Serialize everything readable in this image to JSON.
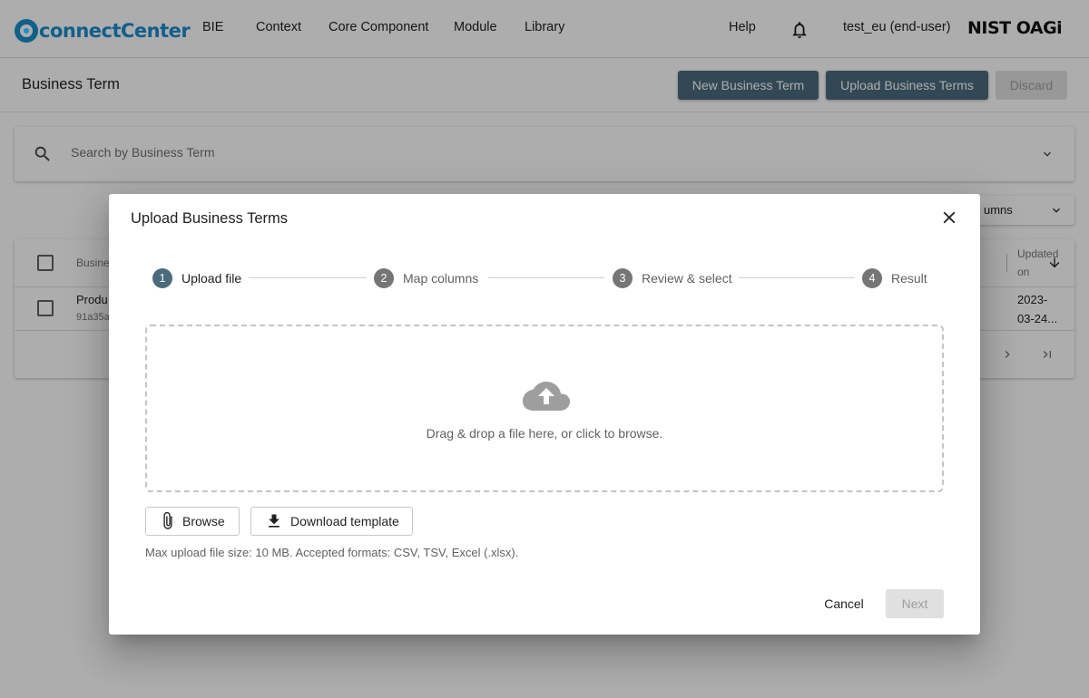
{
  "app": {
    "logo_text": "connectCenter",
    "org_logo": "NIST OAGi"
  },
  "nav": {
    "items": [
      "BIE",
      "Context",
      "Core Component",
      "Module",
      "Library"
    ],
    "help": "Help",
    "user": "test_eu (end-user)"
  },
  "page": {
    "title": "Business Term",
    "buttons": {
      "new": "New Business Term",
      "upload": "Upload Business Terms",
      "discard": "Discard"
    }
  },
  "search": {
    "placeholder": "Search by Business Term"
  },
  "table": {
    "columns_selector": "umns",
    "header_business_term": "Busine",
    "header_updated_on": [
      "Updated",
      "on"
    ],
    "row": {
      "term": "Produ",
      "id": "91a35a",
      "updated_on": [
        "2023-",
        "03-24..."
      ]
    }
  },
  "dialog": {
    "title": "Upload Business Terms",
    "steps": [
      {
        "num": "1",
        "label": "Upload file",
        "active": true
      },
      {
        "num": "2",
        "label": "Map columns",
        "active": false
      },
      {
        "num": "3",
        "label": "Review & select",
        "active": false
      },
      {
        "num": "4",
        "label": "Result",
        "active": false
      }
    ],
    "dropzone_text": "Drag & drop a file here, or click to browse.",
    "browse": "Browse",
    "download_template": "Download template",
    "hint": "Max upload file size: 10 MB. Accepted formats: CSV, TSV, Excel (.xlsx).",
    "cancel": "Cancel",
    "next": "Next"
  },
  "icons": {
    "search": "search-icon",
    "bell": "bell-icon",
    "close": "close-icon",
    "cloud_upload": "cloud-upload-icon",
    "attach": "paperclip-icon",
    "download": "download-icon",
    "chevron": "chevron-down-icon"
  },
  "colors": {
    "brand": "#1a8ccd",
    "primary_button": "#4a6b7c",
    "disabled_button": "#e0e0e0"
  }
}
